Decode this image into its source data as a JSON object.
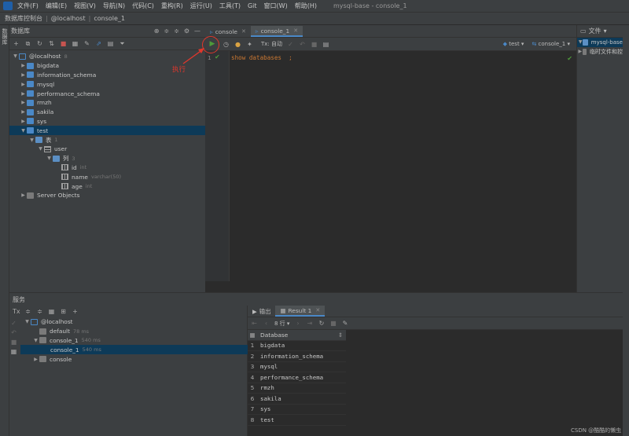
{
  "menubar": {
    "items": [
      "文件(F)",
      "编辑(E)",
      "视图(V)",
      "导航(N)",
      "代码(C)",
      "重构(R)",
      "运行(U)",
      "工具(T)",
      "Git",
      "窗口(W)",
      "帮助(H)"
    ],
    "window_title": "mysql-base - console_1"
  },
  "breadcrumb": {
    "root": "数据库控制台",
    "host": "@localhost",
    "file": "console_1"
  },
  "left_strip": {
    "label": "数据库"
  },
  "db_panel": {
    "title": "数据库",
    "tree": {
      "host": "@localhost",
      "host_count": "8",
      "databases": [
        "bigdata",
        "information_schema",
        "mysql",
        "performance_schema",
        "rmzh",
        "sakila",
        "sys",
        "test"
      ],
      "tables_folder": "表",
      "tables_count": "1",
      "table": "user",
      "columns_folder": "列",
      "columns_count": "3",
      "columns": [
        {
          "name": "id",
          "type": "int"
        },
        {
          "name": "name",
          "type": "varchar(50)"
        },
        {
          "name": "age",
          "type": "int"
        }
      ],
      "server_objects": "Server Objects"
    }
  },
  "editor": {
    "tabs": [
      {
        "label": "console"
      },
      {
        "label": "console_1"
      }
    ],
    "tx_label": "Tx: 自动",
    "schema": "test",
    "console": "console_1",
    "line_number": "1",
    "code": "show databases  ;"
  },
  "annotation": {
    "text": "执行"
  },
  "right_panel": {
    "title": "文件",
    "project": "mysql-base",
    "scratch": "临时文件和控"
  },
  "services": {
    "title": "服务",
    "tree": {
      "host": "@localhost",
      "default": "default",
      "default_time": "78 ms",
      "console1": "console_1",
      "console1_time": "540 ms",
      "console1_child": "console_1",
      "console1_child_time": "540 ms",
      "console": "console"
    }
  },
  "results": {
    "tab_output": "输出",
    "tab_result": "Result 1",
    "rows_label": "8 行",
    "column": "Database",
    "rows": [
      "bigdata",
      "information_schema",
      "mysql",
      "performance_schema",
      "rmzh",
      "sakila",
      "sys",
      "test"
    ]
  },
  "watermark": "CSDN @酷酷的懒虫",
  "colors": {
    "accent": "#4a88c7",
    "selection": "#0d3a58",
    "annotation": "#e0372c",
    "run": "#4e9a3a"
  }
}
